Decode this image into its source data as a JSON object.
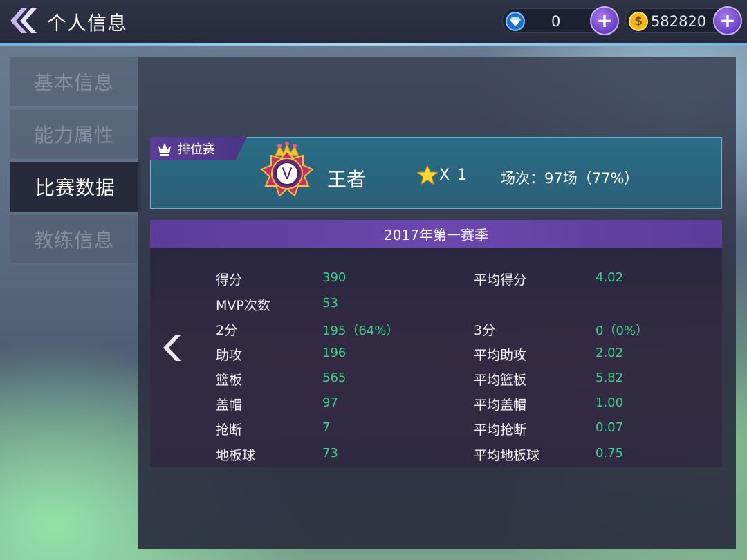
{
  "header": {
    "title": "个人信息",
    "gems": "0",
    "coins": "582820"
  },
  "sidebar": {
    "items": [
      {
        "label": "基本信息",
        "active": false
      },
      {
        "label": "能力属性",
        "active": false
      },
      {
        "label": "比赛数据",
        "active": true
      },
      {
        "label": "教练信息",
        "active": false
      }
    ]
  },
  "rank": {
    "tag": "排位赛",
    "badge_letter": "V",
    "tier": "王者",
    "stars": "X 1",
    "matches": "场次：97场（77%）"
  },
  "season": {
    "title": "2017年第一赛季"
  },
  "stats": {
    "left": [
      {
        "label": "得分",
        "value": "390"
      },
      {
        "label": "MVP次数",
        "value": "53"
      },
      {
        "label": "2分",
        "value": "195（64%）"
      },
      {
        "label": "助攻",
        "value": "196"
      },
      {
        "label": "篮板",
        "value": "565"
      },
      {
        "label": "盖帽",
        "value": "97"
      },
      {
        "label": "抢断",
        "value": "7"
      },
      {
        "label": "地板球",
        "value": "73"
      }
    ],
    "right": [
      {
        "label": "平均得分",
        "value": "4.02"
      },
      {
        "label": "3分",
        "value": "0（0%）"
      },
      {
        "label": "平均助攻",
        "value": "2.02"
      },
      {
        "label": "平均篮板",
        "value": "5.82"
      },
      {
        "label": "平均盖帽",
        "value": "1.00"
      },
      {
        "label": "平均抢断",
        "value": "0.07"
      },
      {
        "label": "平均地板球",
        "value": "0.75"
      }
    ]
  },
  "colors": {
    "stat_value": "#3fd08c",
    "season_bar": "#6c47ae",
    "rank_card": "#2a6d86",
    "accent_line": "#6fb3e0"
  }
}
